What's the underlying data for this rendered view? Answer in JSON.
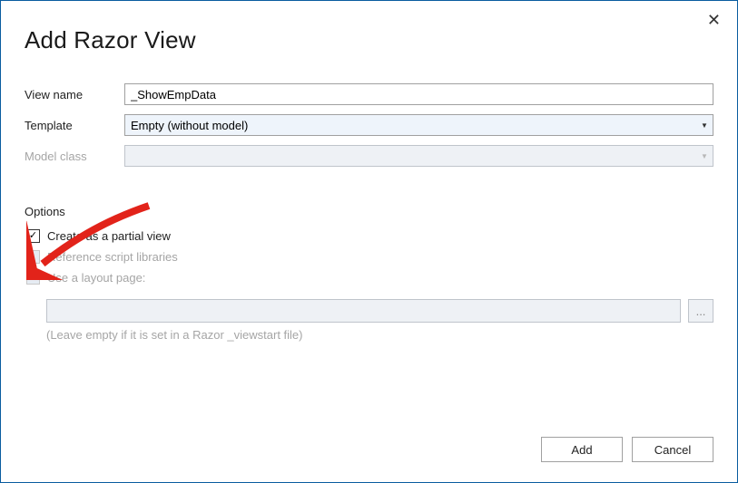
{
  "dialog": {
    "title": "Add Razor View"
  },
  "fields": {
    "viewName": {
      "label": "View name",
      "value": "_ShowEmpData"
    },
    "template": {
      "label": "Template",
      "value": "Empty (without model)"
    },
    "modelClass": {
      "label": "Model class",
      "value": ""
    }
  },
  "options": {
    "header": "Options",
    "partialView": {
      "label": "Create as a partial view",
      "checked": true
    },
    "referenceScripts": {
      "label": "Reference script libraries",
      "checked": false
    },
    "useLayout": {
      "label": "Use a layout page:",
      "checked": true
    },
    "layoutHint": "(Leave empty if it is set in a Razor _viewstart file)"
  },
  "buttons": {
    "add": "Add",
    "cancel": "Cancel",
    "browse": "..."
  }
}
